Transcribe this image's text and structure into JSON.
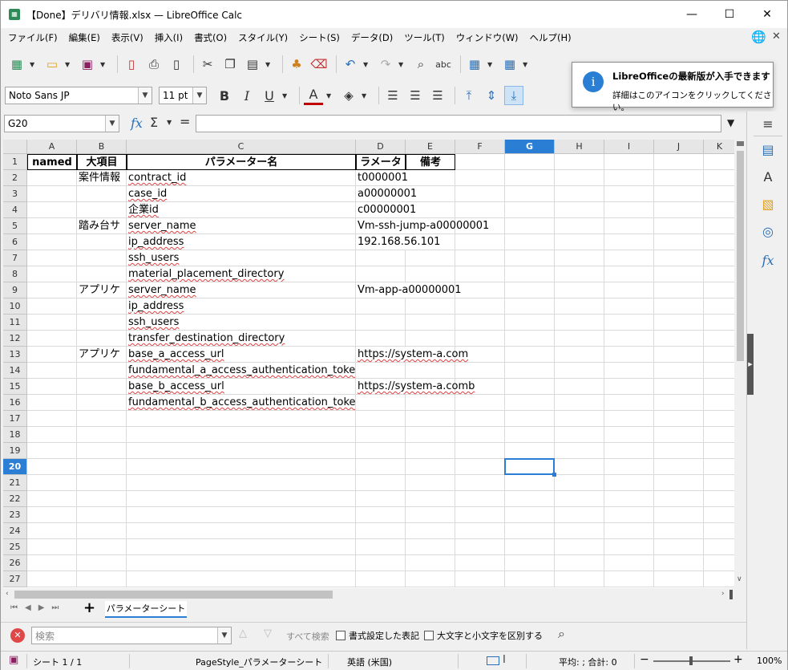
{
  "window": {
    "title": "【Done】デリバリ情報.xlsx — LibreOffice Calc",
    "minimize": "—",
    "maximize": "☐",
    "close": "✕"
  },
  "menu": [
    "ファイル(F)",
    "編集(E)",
    "表示(V)",
    "挿入(I)",
    "書式(O)",
    "スタイル(Y)",
    "シート(S)",
    "データ(D)",
    "ツール(T)",
    "ウィンドウ(W)",
    "ヘルプ(H)"
  ],
  "format": {
    "font_name": "Noto Sans JP",
    "font_size": "11 pt"
  },
  "notification": {
    "title": "LibreOfficeの最新版が入手できます",
    "body": "詳細はこのアイコンをクリックしてください。"
  },
  "formula_bar": {
    "name_box": "G20",
    "input": ""
  },
  "columns": [
    "A",
    "B",
    "C",
    "D",
    "E",
    "F",
    "G",
    "H",
    "I",
    "J",
    "K"
  ],
  "selected": {
    "column": "G",
    "row": 20
  },
  "header_row": {
    "A": "named",
    "B": "大項目",
    "C": "パラメーター名",
    "D": "ラメータ",
    "E": "備考"
  },
  "rows": [
    {
      "n": 2,
      "B": "案件情報",
      "C": "contract_id",
      "D": "t0000001"
    },
    {
      "n": 3,
      "B": "",
      "C": "case_id",
      "D": "a00000001"
    },
    {
      "n": 4,
      "B": "",
      "C": "企業id",
      "D": "c00000001"
    },
    {
      "n": 5,
      "B": "踏み台サ",
      "C": "server_name",
      "D": "Vm-ssh-jump-a00000001"
    },
    {
      "n": 6,
      "B": "",
      "C": "ip_address",
      "D": "192.168.56.101"
    },
    {
      "n": 7,
      "B": "",
      "C": "ssh_users",
      "D": ""
    },
    {
      "n": 8,
      "B": "",
      "C": "material_placement_directory",
      "D": ""
    },
    {
      "n": 9,
      "B": "アプリケ",
      "C": "server_name",
      "D": "Vm-app-a00000001"
    },
    {
      "n": 10,
      "B": "",
      "C": "ip_address",
      "D": ""
    },
    {
      "n": 11,
      "B": "",
      "C": "ssh_users",
      "D": ""
    },
    {
      "n": 12,
      "B": "",
      "C": "transfer_destination_directory",
      "D": ""
    },
    {
      "n": 13,
      "B": "アプリケ",
      "C": "base_a_access_url",
      "D": "https://system-a.com"
    },
    {
      "n": 14,
      "B": "",
      "C": "fundamental_a_access_authentication_token",
      "D": ""
    },
    {
      "n": 15,
      "B": "",
      "C": "base_b_access_url",
      "D": "https://system-a.comb"
    },
    {
      "n": 16,
      "B": "",
      "C": "fundamental_b_access_authentication_token",
      "D": ""
    },
    {
      "n": 17
    },
    {
      "n": 18
    },
    {
      "n": 19
    },
    {
      "n": 20
    },
    {
      "n": 21
    },
    {
      "n": 22
    },
    {
      "n": 23
    },
    {
      "n": 24
    },
    {
      "n": 25
    },
    {
      "n": 26
    },
    {
      "n": 27
    }
  ],
  "sheet_tab": "パラメーターシート",
  "find": {
    "placeholder": "検索",
    "find_all": "すべて検索",
    "formatted": "書式設定した表記",
    "match_case": "大文字と小文字を区別する"
  },
  "status": {
    "sheet": "シート 1 / 1",
    "page_style": "PageStyle_パラメーターシート",
    "language": "英語 (米国)",
    "summary": "平均: ; 合計: 0",
    "zoom": "100%"
  },
  "colors": {
    "accent": "#2a7fd4",
    "selection": "#2a7fd4",
    "spell_error": "#e04040"
  }
}
